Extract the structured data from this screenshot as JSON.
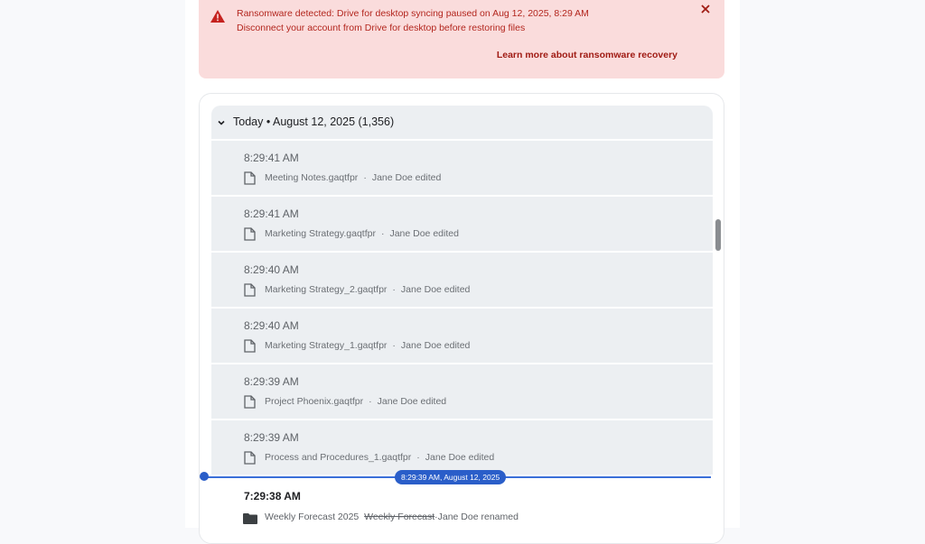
{
  "alert": {
    "title": "Ransomware detected: Drive for desktop syncing paused on Aug 12, 2025, 8:29 AM",
    "subtitle": "Disconnect your account from Drive for desktop before restoring files",
    "link": "Learn more about ransomware recovery",
    "icon": "warning-triangle-icon",
    "accent_color": "#b3261e",
    "background_color": "#fadcdc"
  },
  "activity": {
    "group": {
      "title": "Today • August 12, 2025 (1,356)"
    },
    "entries": [
      {
        "time": "8:29:41 AM",
        "file": "Meeting Notes.gaqtfpr",
        "actor": "Jane Doe edited"
      },
      {
        "time": "8:29:41 AM",
        "file": "Marketing Strategy.gaqtfpr",
        "actor": "Jane Doe edited"
      },
      {
        "time": "8:29:40 AM",
        "file": "Marketing Strategy_2.gaqtfpr",
        "actor": "Jane Doe edited"
      },
      {
        "time": "8:29:40 AM",
        "file": "Marketing Strategy_1.gaqtfpr",
        "actor": "Jane Doe edited"
      },
      {
        "time": "8:29:39 AM",
        "file": "Project Phoenix.gaqtfpr",
        "actor": "Jane Doe edited"
      },
      {
        "time": "8:29:39 AM",
        "file": "Process and Procedures_1.gaqtfpr",
        "actor": "Jane Doe edited"
      }
    ],
    "marker": {
      "label": "8:29:39 AM, August 12, 2025",
      "color": "#2a5ec9"
    },
    "previous_entry": {
      "time": "7:29:38 AM",
      "new_name": "Weekly Forecast 2025",
      "old_name": "Weekly Forecast",
      "actor": "Jane Doe renamed"
    },
    "separator": "·"
  }
}
